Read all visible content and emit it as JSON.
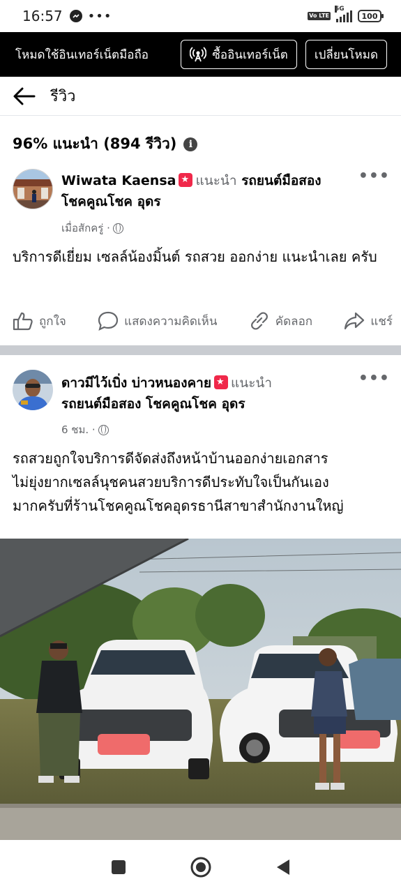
{
  "status_bar": {
    "time": "16:57",
    "network": "5G",
    "volte": "Vo LTE",
    "battery": "100"
  },
  "data_banner": {
    "message": "โหมดใช้อินเทอร์เน็ตมือถือ",
    "buy_label": "ซื้ออินเทอร์เน็ต",
    "switch_label": "เปลี่ยนโหมด"
  },
  "header": {
    "title": "รีวิว"
  },
  "summary": {
    "text": "96% แนะนำ (894 รีวิว)"
  },
  "reviews": [
    {
      "author": "Wiwata Kaensa",
      "recommend": "แนะนำ",
      "page_line1": "รถยนต์มือสอง",
      "page_line2": "โชคคูณโชค อุดร",
      "time": "เมื่อสักครู่ ·",
      "text": "บริการดีเยี่ยม เซลล์น้องมิ้นต์ รถสวย ออกง่าย แนะนำเลย ครับ"
    },
    {
      "author": "ดาวมีไว้เบิ่ง บ่าวหนองคาย",
      "recommend": "แนะนำ",
      "page_line2": "รถยนต์มือสอง โชคคูณโชค อุดร",
      "time": "6 ชม. ·",
      "text_lines": [
        "รถสวยถูกใจบริการดีจัดส่งถึงหน้าบ้านออกง่ายเอกสาร",
        "ไม่ยุ่งยากเซลล์นุชคนสวยบริการดีประทับใจเป็นกันเอง",
        "มากครับที่ร้านโชคคูณโชคอุดรธานีสาขาสำนักงานใหญ่"
      ]
    }
  ],
  "actions": {
    "like": "ถูกใจ",
    "comment": "แสดงความคิดเห็น",
    "copy": "คัดลอก",
    "share": "แชร์"
  }
}
